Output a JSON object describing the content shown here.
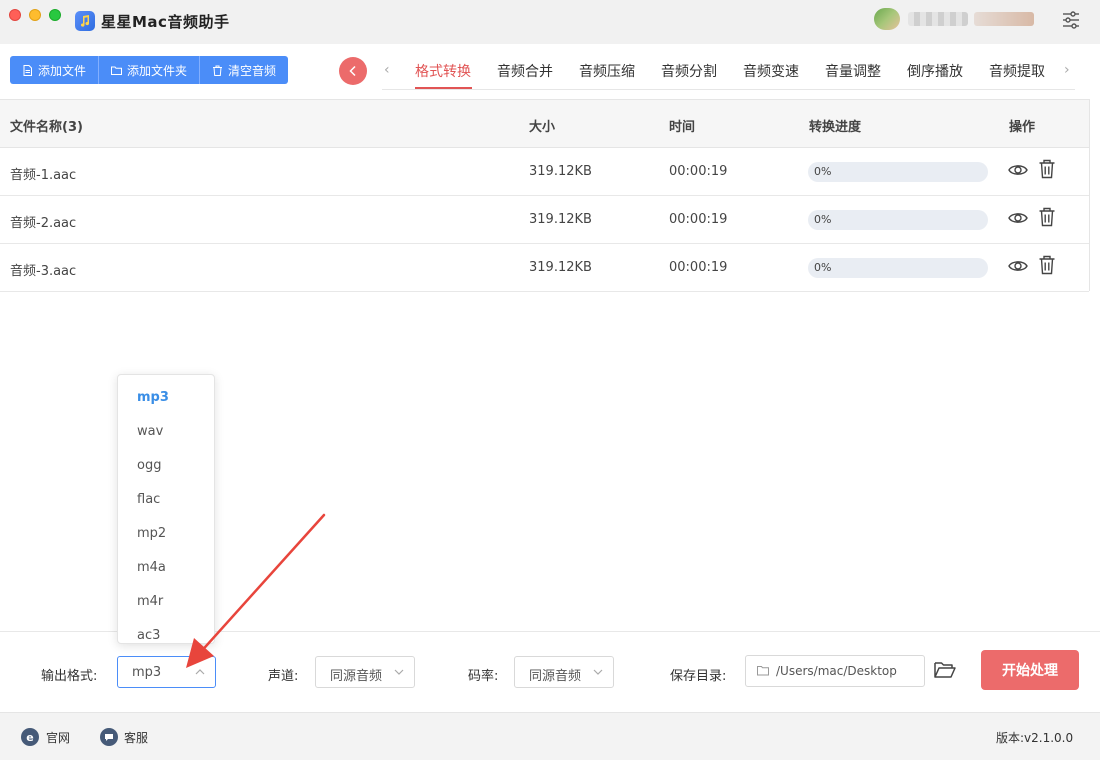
{
  "app": {
    "title": "星星Mac音频助手"
  },
  "toolbar": {
    "add_file": "添加文件",
    "add_folder": "添加文件夹",
    "clear_audio": "清空音频"
  },
  "tabs": [
    {
      "label": "格式转换",
      "active": true
    },
    {
      "label": "音频合并"
    },
    {
      "label": "音频压缩"
    },
    {
      "label": "音频分割"
    },
    {
      "label": "音频变速"
    },
    {
      "label": "音量调整"
    },
    {
      "label": "倒序播放"
    },
    {
      "label": "音频提取"
    }
  ],
  "table": {
    "headers": {
      "name": "文件名称(3)",
      "size": "大小",
      "time": "时间",
      "progress": "转换进度",
      "actions": "操作"
    },
    "rows": [
      {
        "name": "音频-1.aac",
        "size": "319.12KB",
        "time": "00:00:19",
        "progress_text": "0%",
        "progress": 0
      },
      {
        "name": "音频-2.aac",
        "size": "319.12KB",
        "time": "00:00:19",
        "progress_text": "0%",
        "progress": 0
      },
      {
        "name": "音频-3.aac",
        "size": "319.12KB",
        "time": "00:00:19",
        "progress_text": "0%",
        "progress": 0
      }
    ]
  },
  "format_dropdown": {
    "options": [
      "mp3",
      "wav",
      "ogg",
      "flac",
      "mp2",
      "m4a",
      "m4r",
      "ac3"
    ],
    "selected": "mp3"
  },
  "settings": {
    "output_format_label": "输出格式:",
    "output_format_value": "mp3",
    "channel_label": "声道:",
    "channel_value": "同源音频",
    "bitrate_label": "码率:",
    "bitrate_value": "同源音频",
    "save_dir_label": "保存目录:",
    "save_dir_value": "/Users/mac/Desktop",
    "start_button": "开始处理"
  },
  "footer": {
    "website": "官网",
    "support": "客服",
    "version": "版本:v2.1.0.0"
  },
  "colors": {
    "primary_blue": "#4b8df8",
    "accent_red": "#ec6b6b",
    "active_tab": "#e15454"
  }
}
